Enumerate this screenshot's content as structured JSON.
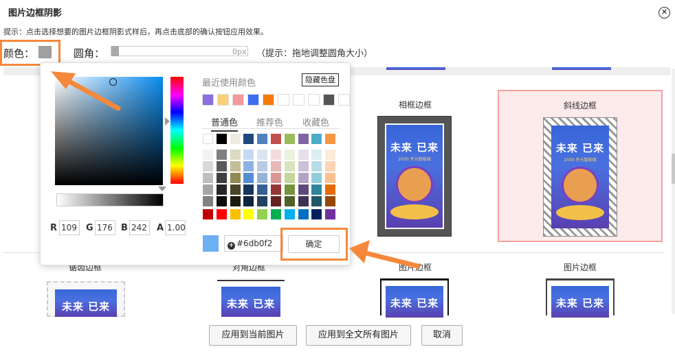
{
  "dialog": {
    "title": "图片边框阴影",
    "close_icon": "close-icon",
    "hint": "提示：点击选择想要的图片边框阴影式样后，再点击底部的确认按钮应用效果。"
  },
  "controls": {
    "color_label": "颜色：",
    "color_value": "#a0a0a0",
    "radius_label": "圆角：",
    "radius_value": "0px",
    "radius_hint": "（提示：拖地调整圆角大小）"
  },
  "gallery": {
    "row1": [
      {
        "label": "相框边框"
      },
      {
        "label": "斜线边框"
      }
    ],
    "row2": [
      {
        "label": "锯齿边框"
      },
      {
        "label": "对角边框"
      },
      {
        "label": "图片边框"
      },
      {
        "label": "图片边框"
      }
    ],
    "poster_text": "未来 已来",
    "poster_sub": "2030 开元智能城"
  },
  "picker": {
    "recent_title": "最近使用颜色",
    "hide_button": "隐藏色盘",
    "recent_colors": [
      "#8a6fe0",
      "#f8d07a",
      "#f29b9b",
      "#3d6ef2",
      "#f57c0a",
      "#ffffff",
      "#ffffff",
      "#ffffff",
      "#555555",
      "#ffffff"
    ],
    "tabs": [
      "普通色",
      "推荐色",
      "收藏色"
    ],
    "active_tab": 0,
    "palette_top": [
      "#ffffff",
      "#000000",
      "#eeece1",
      "#1f497d",
      "#4f81bd",
      "#c0504d",
      "#9bbb59",
      "#8064a2",
      "#4bacc6",
      "#f79646"
    ],
    "palette_cols": [
      [
        "#f2f2f2",
        "#d9d9d9",
        "#bfbfbf",
        "#a6a6a6",
        "#808080"
      ],
      [
        "#7f7f7f",
        "#595959",
        "#3f3f3f",
        "#262626",
        "#0d0d0d"
      ],
      [
        "#ddd9c3",
        "#c4bd97",
        "#938953",
        "#494429",
        "#1d1b10"
      ],
      [
        "#c6d9f0",
        "#8db3e2",
        "#548dd4",
        "#17365d",
        "#0f243e"
      ],
      [
        "#dbe5f1",
        "#b8cce4",
        "#95b3d7",
        "#366092",
        "#244061"
      ],
      [
        "#f2dcdb",
        "#e5b9b7",
        "#d99694",
        "#953734",
        "#632423"
      ],
      [
        "#ebf1dd",
        "#d7e3bc",
        "#c3d69b",
        "#76923c",
        "#4f6128"
      ],
      [
        "#e5e0ec",
        "#ccc1d9",
        "#b2a2c7",
        "#5f497a",
        "#3f3151"
      ],
      [
        "#dbeef3",
        "#b7dde8",
        "#92cddc",
        "#31859b",
        "#205867"
      ],
      [
        "#fdeada",
        "#fbd5b5",
        "#fac08f",
        "#e36c09",
        "#974806"
      ]
    ],
    "palette_bottom": [
      "#c00000",
      "#ff0000",
      "#ffc000",
      "#ffff00",
      "#92d050",
      "#00b050",
      "#00b0f0",
      "#0070c0",
      "#002060",
      "#7030a0"
    ],
    "r_label": "R",
    "r": "109",
    "g_label": "G",
    "g": "176",
    "b_label": "B",
    "b": "242",
    "a_label": "A",
    "a": "1.00",
    "hex": "#6db0f2",
    "preview_color": "#6db0f2",
    "ok_button": "确定"
  },
  "footer": {
    "apply_current": "应用到当前图片",
    "apply_all": "应用到全文所有图片",
    "cancel": "取消"
  },
  "annotation_color": "#f5883a"
}
